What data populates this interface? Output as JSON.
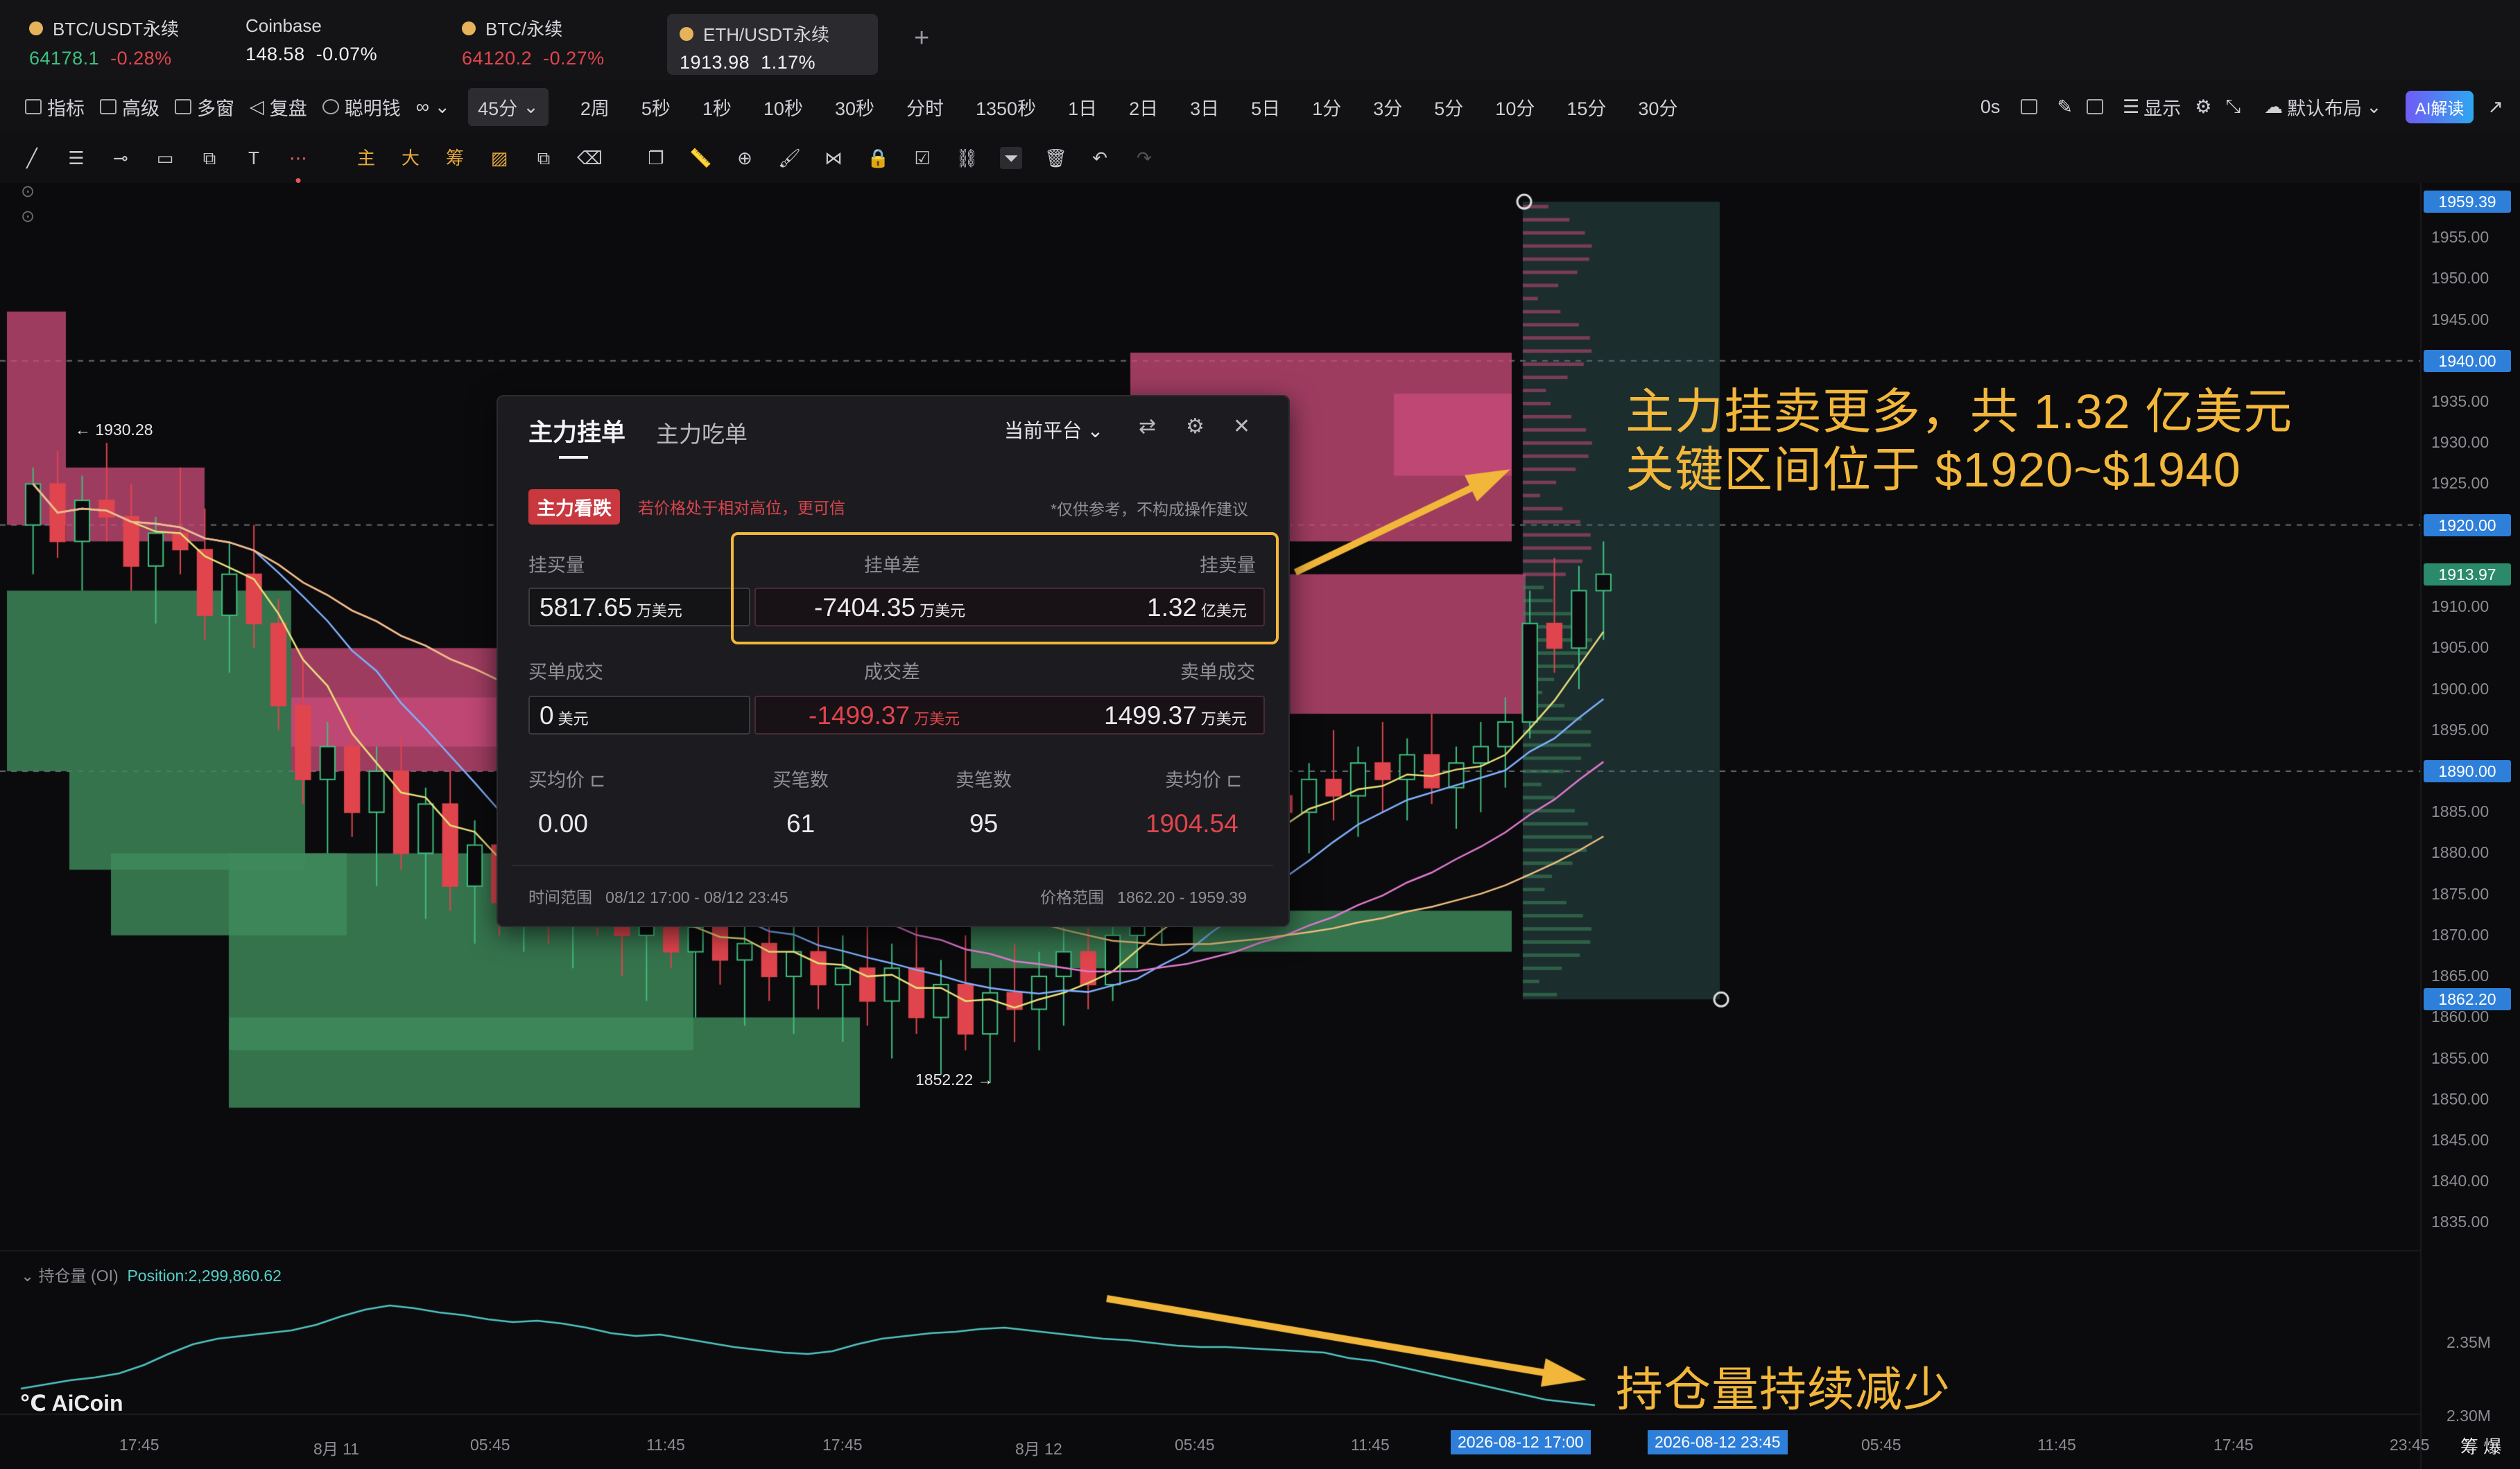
{
  "tickers": [
    {
      "name": "BTC/USDT永续",
      "price": "64178.1",
      "change": "-0.28%",
      "price_color": "up",
      "change_color": "down",
      "dot": "#e6b25a"
    },
    {
      "name": "Coinbase",
      "price": "148.58",
      "change": "-0.07%",
      "price_color": "white",
      "change_color": "white",
      "dot": null
    },
    {
      "name": "BTC/永续",
      "price": "64120.2",
      "change": "-0.27%",
      "price_color": "down",
      "change_color": "down",
      "dot": "#e6b25a"
    },
    {
      "name": "ETH/USDT永续",
      "price": "1913.98",
      "change": "1.17%",
      "price_color": "white",
      "change_color": "white",
      "dot": "#e6b25a",
      "active": true
    }
  ],
  "add_tab_symbol": "+",
  "toolbar": {
    "left_items": [
      "指标",
      "高级",
      "多窗",
      "复盘",
      "聪明钱"
    ],
    "selected_interval": "45分",
    "intervals": [
      "2周",
      "5秒",
      "1秒",
      "10秒",
      "30秒",
      "分时",
      "1350秒",
      "1日",
      "2日",
      "3日",
      "5日",
      "1分",
      "3分",
      "5分",
      "10分",
      "15分",
      "30分"
    ],
    "right_items": [
      "0s",
      "显示",
      "默认布局"
    ],
    "ai_button": "AI解读"
  },
  "draw_tools_text": [
    "T",
    "主",
    "大",
    "筹"
  ],
  "chart": {
    "price_ticks": [
      "1955.00",
      "1950.00",
      "1945.00",
      "1935.00",
      "1930.00",
      "1925.00",
      "1910.00",
      "1905.00",
      "1900.00",
      "1895.00",
      "1885.00",
      "1880.00",
      "1875.00",
      "1870.00",
      "1865.00",
      "1860.00",
      "1855.00",
      "1850.00",
      "1845.00",
      "1840.00",
      "1835.00"
    ],
    "price_tags": [
      {
        "label": "1959.39",
        "color": "#2e7fd9"
      },
      {
        "label": "1940.00",
        "color": "#2e7fd9"
      },
      {
        "label": "1920.00",
        "color": "#2e7fd9"
      },
      {
        "label": "1913.97",
        "color": "#2a8a6a"
      },
      {
        "label": "1890.00",
        "color": "#2e7fd9"
      },
      {
        "label": "1862.20",
        "color": "#2e7fd9"
      }
    ],
    "price_range": [
      1832,
      1961
    ],
    "time_ticks": [
      "17:45",
      "8月 11",
      "05:45",
      "11:45",
      "17:45",
      "8月 12",
      "05:45",
      "11:45",
      "05:45",
      "11:45",
      "17:45",
      "23:45"
    ],
    "time_highlights": [
      "2026-08-12 17:00",
      "2026-08-12 23:45"
    ],
    "high_label": "← 1930.28",
    "low_label": "1852.22 →",
    "oi_label": "持仓量 (OI)",
    "oi_value": "Position:2,299,860.62",
    "oi_ticks": [
      "2.35M",
      "2.30M"
    ],
    "logo": "AiCoin",
    "footer_right": "筹 爆",
    "candles": [
      [
        1920,
        1927,
        1914,
        1925
      ],
      [
        1925,
        1929,
        1916,
        1918
      ],
      [
        1918,
        1926,
        1912,
        1923
      ],
      [
        1923,
        1930,
        1918,
        1921
      ],
      [
        1921,
        1925,
        1912,
        1915
      ],
      [
        1915,
        1921,
        1908,
        1919
      ],
      [
        1919,
        1927,
        1914,
        1917
      ],
      [
        1917,
        1922,
        1906,
        1909
      ],
      [
        1909,
        1918,
        1902,
        1914
      ],
      [
        1914,
        1920,
        1905,
        1908
      ],
      [
        1908,
        1911,
        1895,
        1898
      ],
      [
        1898,
        1904,
        1886,
        1889
      ],
      [
        1889,
        1896,
        1880,
        1893
      ],
      [
        1893,
        1897,
        1882,
        1885
      ],
      [
        1885,
        1893,
        1876,
        1890
      ],
      [
        1890,
        1894,
        1878,
        1880
      ],
      [
        1880,
        1888,
        1872,
        1886
      ],
      [
        1886,
        1890,
        1873,
        1876
      ],
      [
        1876,
        1884,
        1869,
        1881
      ],
      [
        1881,
        1885,
        1870,
        1874
      ],
      [
        1874,
        1882,
        1868,
        1879
      ],
      [
        1879,
        1884,
        1869,
        1872
      ],
      [
        1872,
        1880,
        1866,
        1877
      ],
      [
        1877,
        1883,
        1870,
        1873
      ],
      [
        1873,
        1878,
        1865,
        1870
      ],
      [
        1870,
        1876,
        1862,
        1873
      ],
      [
        1873,
        1879,
        1866,
        1868
      ],
      [
        1868,
        1874,
        1860,
        1871
      ],
      [
        1871,
        1877,
        1864,
        1867
      ],
      [
        1867,
        1872,
        1859,
        1869
      ],
      [
        1869,
        1875,
        1862,
        1865
      ],
      [
        1865,
        1871,
        1858,
        1868
      ],
      [
        1868,
        1874,
        1861,
        1864
      ],
      [
        1864,
        1870,
        1857,
        1866
      ],
      [
        1866,
        1872,
        1859,
        1862
      ],
      [
        1862,
        1869,
        1855,
        1866
      ],
      [
        1866,
        1871,
        1858,
        1860
      ],
      [
        1860,
        1867,
        1853,
        1864
      ],
      [
        1864,
        1870,
        1856,
        1858
      ],
      [
        1858,
        1866,
        1852,
        1863
      ],
      [
        1863,
        1869,
        1857,
        1861
      ],
      [
        1861,
        1868,
        1856,
        1865
      ],
      [
        1865,
        1871,
        1859,
        1868
      ],
      [
        1868,
        1872,
        1861,
        1864
      ],
      [
        1864,
        1873,
        1862,
        1870
      ],
      [
        1870,
        1876,
        1866,
        1874
      ],
      [
        1874,
        1880,
        1869,
        1877
      ],
      [
        1877,
        1882,
        1871,
        1879
      ],
      [
        1879,
        1885,
        1874,
        1882
      ],
      [
        1882,
        1888,
        1876,
        1884
      ],
      [
        1884,
        1890,
        1879,
        1887
      ],
      [
        1887,
        1892,
        1881,
        1885
      ],
      [
        1885,
        1891,
        1880,
        1889
      ],
      [
        1889,
        1895,
        1884,
        1887
      ],
      [
        1887,
        1893,
        1882,
        1891
      ],
      [
        1891,
        1896,
        1885,
        1889
      ],
      [
        1889,
        1894,
        1884,
        1892
      ],
      [
        1892,
        1897,
        1886,
        1888
      ],
      [
        1888,
        1893,
        1883,
        1891
      ],
      [
        1891,
        1896,
        1885,
        1893
      ],
      [
        1893,
        1899,
        1888,
        1896
      ],
      [
        1896,
        1912,
        1894,
        1908
      ],
      [
        1908,
        1916,
        1902,
        1905
      ],
      [
        1905,
        1915,
        1900,
        1912
      ],
      [
        1912,
        1918,
        1906,
        1914
      ]
    ],
    "oi_series": [
      0.3,
      0.33,
      0.36,
      0.38,
      0.41,
      0.47,
      0.55,
      0.62,
      0.66,
      0.68,
      0.7,
      0.72,
      0.76,
      0.82,
      0.87,
      0.9,
      0.88,
      0.85,
      0.83,
      0.8,
      0.78,
      0.79,
      0.77,
      0.74,
      0.7,
      0.68,
      0.69,
      0.66,
      0.63,
      0.6,
      0.58,
      0.56,
      0.55,
      0.57,
      0.62,
      0.66,
      0.68,
      0.7,
      0.71,
      0.73,
      0.74,
      0.72,
      0.7,
      0.68,
      0.66,
      0.65,
      0.63,
      0.61,
      0.6,
      0.6,
      0.59,
      0.58,
      0.57,
      0.56,
      0.52,
      0.5,
      0.46,
      0.42,
      0.38,
      0.34,
      0.3,
      0.26,
      0.22,
      0.2,
      0.18
    ]
  },
  "panel": {
    "tab_active": "主力挂单",
    "tab_other": "主力吃单",
    "platform": "当前平台",
    "badge": "主力看跌",
    "badge_hint": "若价格处于相对高位，更可信",
    "disclaimer": "*仅供参考，不构成操作建议",
    "buy_orders_label": "挂买量",
    "buy_orders_value": "5817.65",
    "diff_label": "挂单差",
    "diff_value": "-7404.35",
    "sell_orders_label": "挂卖量",
    "sell_orders_value": "1.32",
    "unit_wan": "万美元",
    "unit_yi": "亿美元",
    "buy_fill_label": "买单成交",
    "buy_fill_value": "0",
    "fill_diff_label": "成交差",
    "fill_diff_value": "-1499.37",
    "sell_fill_label": "卖单成交",
    "sell_fill_value": "1499.37",
    "unit_yuan": "美元",
    "buy_avg_label": "买均价",
    "buy_avg_value": "0.00",
    "buy_count_label": "买笔数",
    "buy_count_value": "61",
    "sell_count_label": "卖笔数",
    "sell_count_value": "95",
    "sell_avg_label": "卖均价",
    "sell_avg_value": "1904.54",
    "time_range_label": "时间范围",
    "time_range_value": "08/12 17:00 - 08/12 23:45",
    "price_range_label": "价格范围",
    "price_range_value": "1862.20 - 1959.39"
  },
  "annotations": {
    "line1": "主力挂卖更多，共 1.32 亿美元",
    "line2": "关键区间位于 $1920~$1940",
    "line3": "持仓量持续减少"
  },
  "colors": {
    "up": "#3fbf7f",
    "down": "#e0454d",
    "accent": "#f2b73a",
    "sellzone": "#c84a78",
    "buyzone": "#3e8a5c"
  }
}
